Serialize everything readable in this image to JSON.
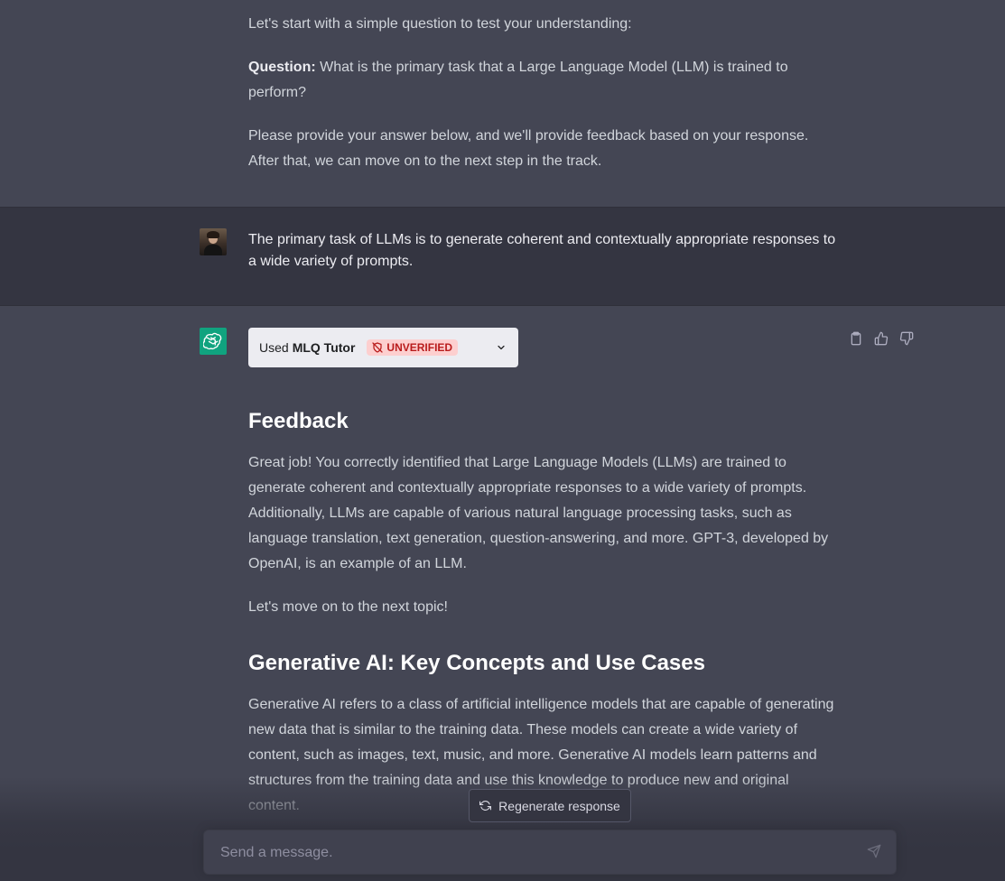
{
  "messages": {
    "assistant_intro": {
      "line1": "Let's start with a simple question to test your understanding:",
      "question_label": "Question:",
      "question_text": " What is the primary task that a Large Language Model (LLM) is trained to perform?",
      "followup": "Please provide your answer below, and we'll provide feedback based on your response. After that, we can move on to the next step in the track."
    },
    "user_reply": "The primary task of LLMs is to generate coherent and contextually appropriate responses to a wide variety of prompts.",
    "assistant_feedback": {
      "plugin": {
        "used_label": "Used",
        "plugin_name": "MLQ Tutor",
        "badge": "UNVERIFIED"
      },
      "heading1": "Feedback",
      "para1": "Great job! You correctly identified that Large Language Models (LLMs) are trained to generate coherent and contextually appropriate responses to a wide variety of prompts. Additionally, LLMs are capable of various natural language processing tasks, such as language translation, text generation, question-answering, and more. GPT-3, developed by OpenAI, is an example of an LLM.",
      "para2": "Let's move on to the next topic!",
      "heading2": "Generative AI: Key Concepts and Use Cases",
      "para3": "Generative AI refers to a class of artificial intelligence models that are capable of generating new data that is similar to the training data. These models can create a wide variety of content, such as images, text, music, and more. Generative AI models learn patterns and structures from the training data and use this knowledge to produce new and original content."
    }
  },
  "actions": {
    "icons": [
      "clipboard-icon",
      "thumbs-up-icon",
      "thumbs-down-icon"
    ]
  },
  "regenerate": {
    "label": "Regenerate response"
  },
  "composer": {
    "placeholder": "Send a message."
  },
  "colors": {
    "assistant_bg": "#444654",
    "user_bg": "#343541",
    "brand_green": "#10a37f",
    "badge_bg": "#fdcfcf",
    "badge_text": "#b91c1c"
  }
}
